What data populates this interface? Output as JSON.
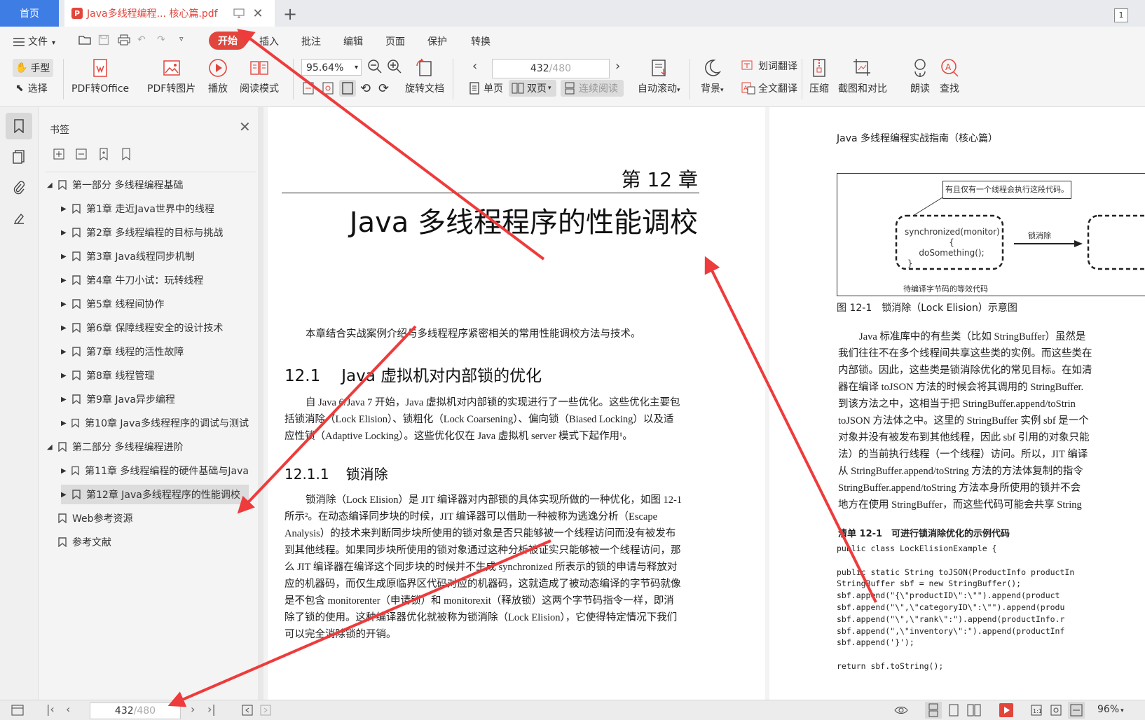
{
  "tabs": {
    "home": "首页",
    "document": "Java多线程编程... 核心篇.pdf",
    "count": "1"
  },
  "menu": {
    "file": "文件",
    "start": "开始",
    "insert": "插入",
    "annotate": "批注",
    "edit": "编辑",
    "page": "页面",
    "protect": "保护",
    "convert": "转换"
  },
  "toolbar": {
    "hand": "手型",
    "select": "选择",
    "pdf_to_office": "PDF转Office",
    "pdf_to_image": "PDF转图片",
    "play": "播放",
    "read_mode": "阅读模式",
    "zoom": "95.64%",
    "rotate": "旋转文档",
    "page_current": "432",
    "page_total": "/480",
    "single": "单页",
    "double": "双页",
    "continuous": "连续阅读",
    "auto_scroll": "自动滚动",
    "background": "背景",
    "word_translate": "划词翻译",
    "full_translate": "全文翻译",
    "compress": "压缩",
    "screenshot_compare": "截图和对比",
    "read_aloud": "朗读",
    "search": "查找"
  },
  "bookmarks": {
    "title": "书签",
    "items": [
      {
        "label": "第一部分 多线程编程基础",
        "level": 0,
        "expanded": true
      },
      {
        "label": "第1章 走近Java世界中的线程",
        "level": 1
      },
      {
        "label": "第2章 多线程编程的目标与挑战",
        "level": 1
      },
      {
        "label": "第3章 Java线程同步机制",
        "level": 1
      },
      {
        "label": "第4章 牛刀小试：玩转线程",
        "level": 1
      },
      {
        "label": "第5章 线程间协作",
        "level": 1
      },
      {
        "label": "第6章 保障线程安全的设计技术",
        "level": 1
      },
      {
        "label": "第7章 线程的活性故障",
        "level": 1
      },
      {
        "label": "第8章 线程管理",
        "level": 1
      },
      {
        "label": "第9章 Java异步编程",
        "level": 1
      },
      {
        "label": "第10章 Java多线程程序的调试与测试",
        "level": 1
      },
      {
        "label": "第二部分 多线程编程进阶",
        "level": 0,
        "expanded": true
      },
      {
        "label": "第11章 多线程编程的硬件基础与Java",
        "level": 1
      },
      {
        "label": "第12章 Java多线程程序的性能调校",
        "level": 1,
        "selected": true
      },
      {
        "label": "Web参考资源",
        "level": 0,
        "leaf": true
      },
      {
        "label": "参考文献",
        "level": 0,
        "leaf": true
      }
    ]
  },
  "page_left": {
    "chapter": "第 12 章",
    "title": "Java 多线程程序的性能调校",
    "intro": "本章结合实战案例介绍与多线程程序紧密相关的常用性能调校方法与技术。",
    "s1_num": "12.1",
    "s1_title": "Java 虚拟机对内部锁的优化",
    "s1_lines": [
      "自 Java 6/Java 7 开始，Java 虚拟机对内部锁的实现进行了一些优化。这些优化主要包",
      "括锁消除（Lock Elision）、锁粗化（Lock Coarsening）、偏向锁（Biased Locking）以及适",
      "应性锁（Adaptive Locking）。这些优化仅在 Java 虚拟机 server 模式下起作用¹。"
    ],
    "s2_num": "12.1.1",
    "s2_title": "锁消除",
    "s2_lines": [
      "锁消除（Lock Elision）是 JIT 编译器对内部锁的具体实现所做的一种优化，如图 12-1",
      "所示²。在动态编译同步块的时候，JIT 编译器可以借助一种被称为逃逸分析（Escape",
      "Analysis）的技术来判断同步块所使用的锁对象是否只能够被一个线程访问而没有被发布",
      "到其他线程。如果同步块所使用的锁对象通过这种分析被证实只能够被一个线程访问，那",
      "么 JIT 编译器在编译这个同步块的时候并不生成 synchronized 所表示的锁的申请与释放对",
      "应的机器码，而仅生成原临界区代码对应的机器码，这就造成了被动态编译的字节码就像",
      "是不包含 monitorenter（申请锁）和 monitorexit（释放锁）这两个字节码指令一样，即消",
      "除了锁的使用。这种编译器优化就被称为锁消除（Lock Elision），它使得特定情况下我们",
      "可以完全消除锁的开销。"
    ]
  },
  "page_right": {
    "header": "Java 多线程编程实战指南（核心篇）",
    "fig_note": "有且仅有一个线程会执行这段代码。",
    "fig_code": [
      "synchronized(monitor){",
      "doSomething();",
      "}"
    ],
    "fig_arrow": "锁消除",
    "fig_sub": "待编译字节码的等效代码",
    "fig_caption": "图 12-1　锁消除（Lock Elision）示意图",
    "para_lines": [
      "Java 标准库中的有些类（比如 StringBuffer）虽然是",
      "我们往往不在多个线程间共享这些类的实例。而这些类在",
      "内部锁。因此，这些类是锁消除优化的常见目标。在如清",
      "器在编译 toJSON 方法的时候会将其调用的 StringBuffer.",
      "到该方法之中，这相当于把 StringBuffer.append/toStrin",
      "toJSON 方法体之中。这里的 StringBuffer 实例 sbf 是一个",
      "对象并没有被发布到其他线程，因此 sbf 引用的对象只能",
      "法）的当前执行线程（一个线程）访问。所以，JIT 编译",
      "从 StringBuffer.append/toString 方法的方法体复制的指令",
      "StringBuffer.append/toString 方法本身所使用的锁并不会",
      "地方在使用 StringBuffer，而这些代码可能会共享 String"
    ],
    "listing_title": "清单 12-1　可进行锁消除优化的示例代码",
    "code_lines": [
      "public class LockElisionExample {",
      "",
      "  public static String toJSON(ProductInfo productIn",
      "    StringBuffer sbf = new StringBuffer();",
      "    sbf.append(\"{\\\"productID\\\":\\\"\").append(product",
      "    sbf.append(\"\\\",\\\"categoryID\\\":\\\"\").append(produ",
      "    sbf.append(\"\\\",\\\"rank\\\":\").append(productInfo.r",
      "    sbf.append(\",\\\"inventory\\\":\").append(productInf",
      "    sbf.append('}');",
      "",
      "    return sbf.toString();"
    ]
  },
  "statusbar": {
    "page_current": "432",
    "page_total": "/480",
    "zoom": "96%"
  },
  "colors": {
    "accent_blue": "#3d7de4",
    "accent_red": "#e2453c",
    "annotation_arrow": "#ee3b3b"
  }
}
